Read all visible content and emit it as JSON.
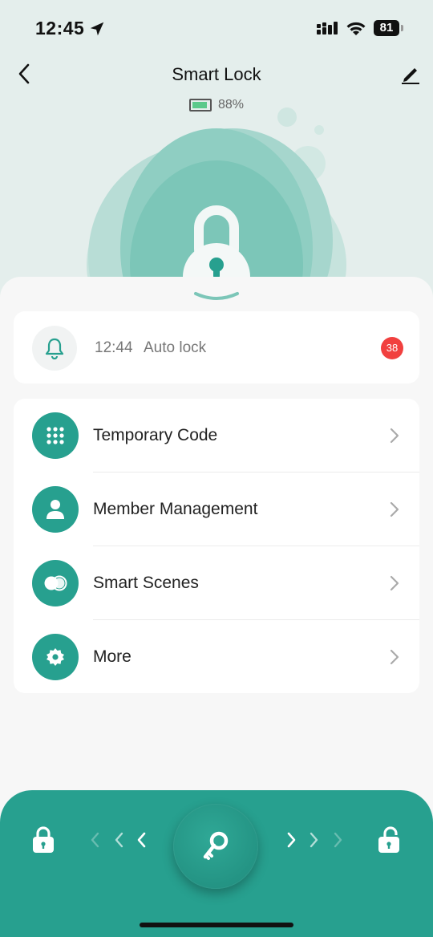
{
  "status_bar": {
    "time": "12:45",
    "battery": "81"
  },
  "header": {
    "title": "Smart Lock"
  },
  "device": {
    "battery_percent": "88%",
    "battery_level": 0.88
  },
  "log": {
    "time": "12:44",
    "text": "Auto lock",
    "badge": "38"
  },
  "menu": [
    {
      "label": "Temporary Code",
      "icon": "keypad-icon"
    },
    {
      "label": "Member Management",
      "icon": "person-icon"
    },
    {
      "label": "Smart Scenes",
      "icon": "toggle-icon"
    },
    {
      "label": "More",
      "icon": "gear-icon"
    }
  ],
  "colors": {
    "accent": "#27a08f",
    "badge": "#f1403f",
    "header_bg": "#e4eeec"
  }
}
